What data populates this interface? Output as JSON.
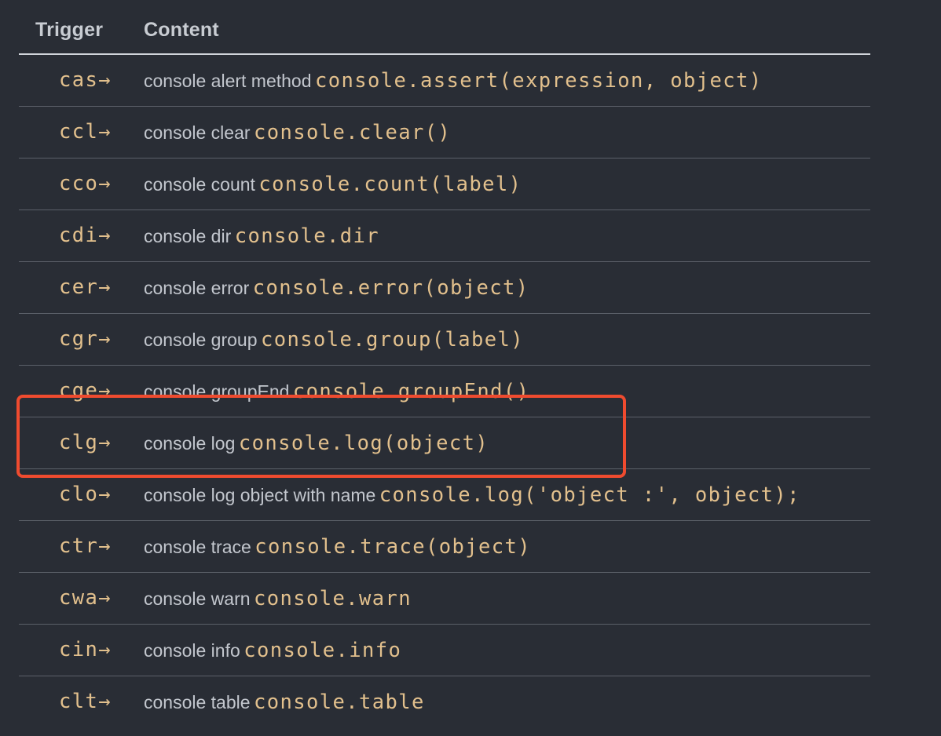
{
  "table": {
    "headers": {
      "trigger": "Trigger",
      "content": "Content"
    },
    "rows": [
      {
        "trigger": "cas→",
        "description": "console alert method",
        "code": "console.assert(expression, object)"
      },
      {
        "trigger": "ccl→",
        "description": "console clear",
        "code": "console.clear()"
      },
      {
        "trigger": "cco→",
        "description": "console count",
        "code": "console.count(label)"
      },
      {
        "trigger": "cdi→",
        "description": "console dir",
        "code": "console.dir"
      },
      {
        "trigger": "cer→",
        "description": "console error",
        "code": "console.error(object)"
      },
      {
        "trigger": "cgr→",
        "description": "console group",
        "code": "console.group(label)"
      },
      {
        "trigger": "cge→",
        "description": "console groupEnd",
        "code": "console.groupEnd()"
      },
      {
        "trigger": "clg→",
        "description": "console log",
        "code": "console.log(object)"
      },
      {
        "trigger": "clo→",
        "description": "console log object with name",
        "code": "console.log('object :', object);"
      },
      {
        "trigger": "ctr→",
        "description": "console trace",
        "code": "console.trace(object)"
      },
      {
        "trigger": "cwa→",
        "description": "console warn",
        "code": "console.warn"
      },
      {
        "trigger": "cin→",
        "description": "console info",
        "code": "console.info"
      },
      {
        "trigger": "clt→",
        "description": "console table",
        "code": "console.table"
      }
    ]
  },
  "highlight": {
    "row_index": 7,
    "color": "#ef4b2f"
  },
  "colors": {
    "background": "#292d35",
    "code": "#e2c08d",
    "text": "#c3c7ce",
    "header_rule": "#d1d5db",
    "row_rule": "#5b6069"
  }
}
